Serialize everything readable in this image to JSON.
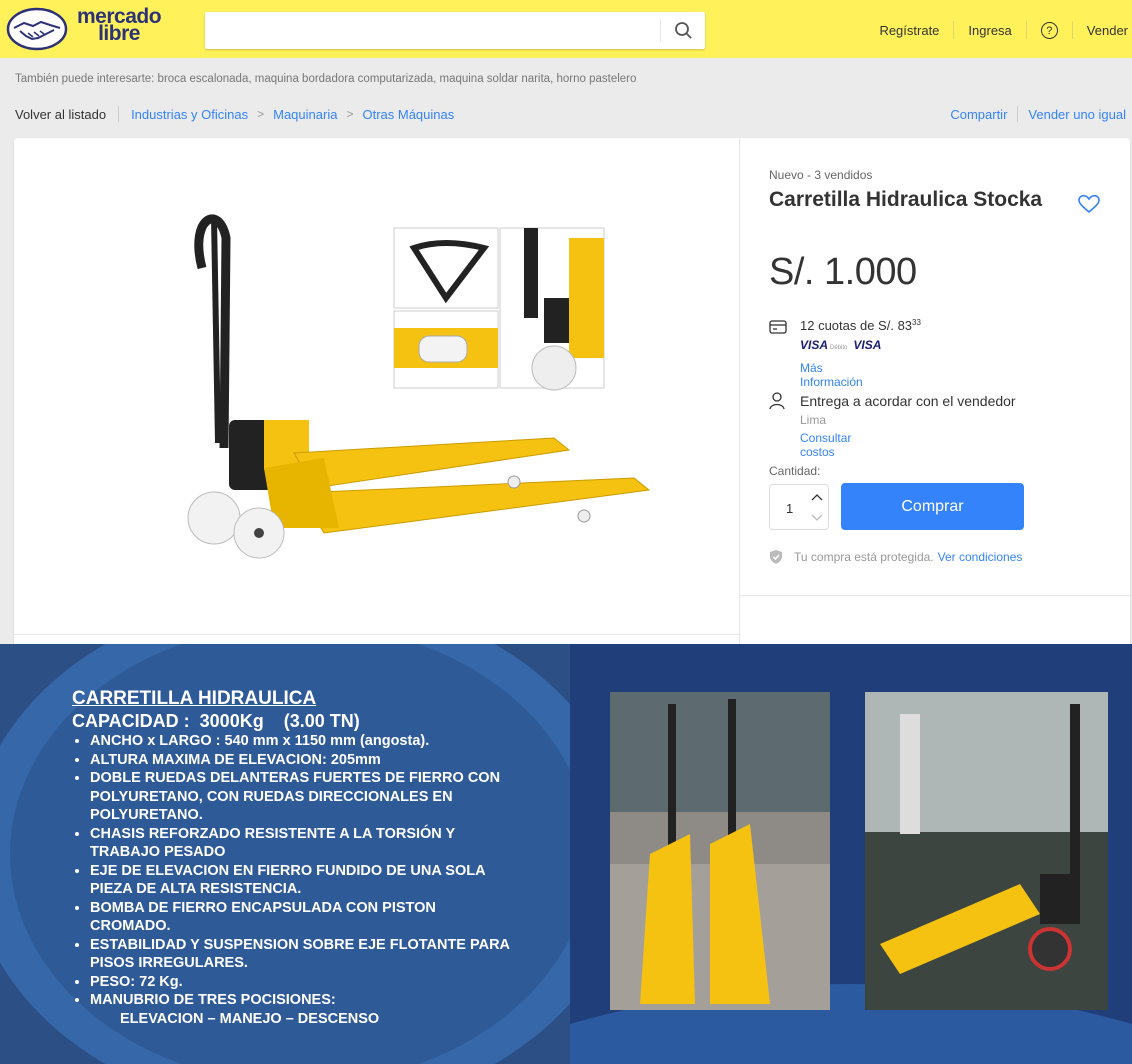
{
  "header": {
    "logo_text_1": "mercado",
    "logo_text_2": "libre",
    "search_placeholder": "",
    "links": [
      "Regístrate",
      "Ingresa",
      "?",
      "Vender"
    ]
  },
  "suggestions": "También puede interesarte: broca escalonada, maquina bordadora computarizada, maquina soldar narita, horno pastelero",
  "breadcrumb": {
    "back": "Volver al listado",
    "path": [
      "Industrias y Oficinas",
      "Maquinaria",
      "Otras Máquinas"
    ],
    "share": "Compartir",
    "sell_same": "Vender uno igual"
  },
  "product": {
    "condition": "Nuevo  -  3 vendidos",
    "title": "Carretilla Hidraulica Stocka",
    "price": "S/. 1.000",
    "installments": "12 cuotas de S/. 83",
    "installments_cents": "33",
    "card_1": "VISA",
    "card_1_sub": "Débito",
    "card_2": "VISA",
    "more_info": "Más Información",
    "delivery": "Entrega a acordar con el vendedor",
    "location": "Lima",
    "consult": "Consultar costos",
    "quantity_label": "Cantidad:",
    "quantity": "1",
    "buy": "Comprar",
    "protected": "Tu compra está protegida.",
    "conditions": "Ver condiciones"
  },
  "banner": {
    "title": "CARRETILLA HIDRAULICA",
    "capacity": "CAPACIDAD :  3000Kg    (3.00 TN)",
    "specs": [
      "ANCHO x LARGO : 540 mm x 1150 mm (angosta).",
      "ALTURA MAXIMA DE ELEVACION:  205mm",
      "DOBLE  RUEDAS  DELANTERAS FUERTES DE FIERRO CON POLYURETANO, CON RUEDAS DIRECCIONALES EN POLYURETANO.",
      "CHASIS REFORZADO RESISTENTE A LA TORSIÓN Y TRABAJO PESADO",
      "EJE DE ELEVACION  EN FIERRO FUNDIDO DE UNA SOLA PIEZA DE ALTA RESISTENCIA.",
      "BOMBA DE FIERRO ENCAPSULADA CON PISTON CROMADO.",
      "ESTABILIDAD Y SUSPENSION SOBRE EJE FLOTANTE PARA PISOS IRREGULARES.",
      "PESO: 72 Kg.",
      "MANUBRIO DE TRES POCISIONES:"
    ],
    "last_line": "ELEVACION – MANEJO – DESCENSO"
  },
  "colors": {
    "header": "#fff159",
    "accent": "#3483fa",
    "banner": "#2c4f86"
  }
}
